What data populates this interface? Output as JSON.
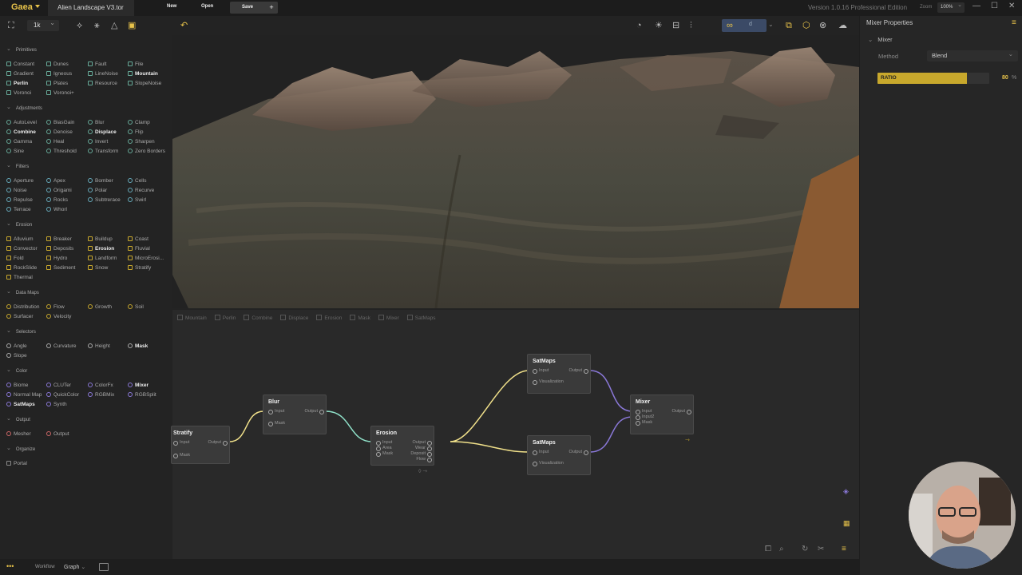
{
  "titlebar": {
    "app_name": "Gaea",
    "document_tab": "Alien Landscape V3.tor",
    "menu_new": "New",
    "menu_open": "Open",
    "menu_save": "Save",
    "menu_plus": "+",
    "version": "Version 1.0.16 Professional Edition",
    "zoom_label": "Zoom",
    "zoom_value": "100%",
    "accent_color": "#e8c34a"
  },
  "toolbar": {
    "resolution": "1k",
    "split_text": "d",
    "icons": [
      "frame-icon",
      "symmetry-icon",
      "wand-icon",
      "terrain-icon",
      "viewport-icon",
      "undo-icon",
      "dial-icon",
      "sun-icon",
      "chart-icon",
      "sliders-icon",
      "glasses-icon",
      "cube-outline-icon",
      "cube-icon",
      "close-circle-icon",
      "cloud-icon"
    ]
  },
  "library": {
    "categories": [
      {
        "label": "Primitives",
        "items": [
          "Constant",
          "Dunes",
          "Fault",
          "File",
          "Gradient",
          "Igneous",
          "LineNoise",
          "Mountain",
          "Perlin",
          "Plates",
          "Resource",
          "SlopeNoise",
          "Voronoi",
          "Voronoi+"
        ]
      },
      {
        "label": "Adjustments",
        "items": [
          "AutoLevel",
          "BiasGain",
          "Blur",
          "Clamp",
          "Combine",
          "Denoise",
          "Displace",
          "Flip",
          "Gamma",
          "Heal",
          "Invert",
          "Sharpen",
          "Sine",
          "Threshold",
          "Transform",
          "Zero Borders"
        ]
      },
      {
        "label": "Filters",
        "items": [
          "Aperture",
          "Apex",
          "Bomber",
          "Cells",
          "Noise",
          "Origami",
          "Polar",
          "Recurve",
          "Repulse",
          "Rocks",
          "Subtrerace",
          "Swirl",
          "Terrace",
          "Whorl"
        ]
      },
      {
        "label": "Erosion",
        "items": [
          "Alluvium",
          "Breaker",
          "Buildup",
          "Coast",
          "Convector",
          "Deposits",
          "Erosion",
          "Fluvial",
          "Fold",
          "Hydro",
          "Landform",
          "MicroErosi...",
          "RockSlide",
          "Sediment",
          "Snow",
          "Stratify",
          "Thermal"
        ]
      },
      {
        "label": "Data Maps",
        "items": [
          "Distribution",
          "Flow",
          "Growth",
          "Soil",
          "Surfacer",
          "Velocity"
        ]
      },
      {
        "label": "Selectors",
        "items": [
          "Angle",
          "Curvature",
          "Height",
          "Mask",
          "Slope"
        ]
      },
      {
        "label": "Color",
        "items": [
          "Biome",
          "CLUTer",
          "ColorFx",
          "Mixer",
          "Normal Map",
          "QuickColor",
          "RGBMix",
          "RGBSplit",
          "SatMaps",
          "Synth"
        ]
      },
      {
        "label": "Output",
        "items": [
          "Mesher",
          "Output"
        ]
      },
      {
        "label": "Organize",
        "items": [
          "Portal"
        ]
      }
    ]
  },
  "graph": {
    "breadcrumb": [
      "Mountain",
      "Perlin",
      "Combine",
      "Displace",
      "Erosion",
      "Mask",
      "Mixer",
      "SatMaps"
    ],
    "nodes": {
      "stratify": {
        "title": "Stratify",
        "inputs": [
          "Input",
          "Mask"
        ],
        "outputs": [
          "Output"
        ]
      },
      "blur": {
        "title": "Blur",
        "inputs": [
          "Input",
          "Mask"
        ],
        "outputs": [
          "Output"
        ]
      },
      "erosion": {
        "title": "Erosion",
        "inputs": [
          "Input",
          "Area",
          "Mask"
        ],
        "outputs": [
          "Output",
          "Wear",
          "Deposit",
          "Flow"
        ]
      },
      "satmaps1": {
        "title": "SatMaps",
        "inputs": [
          "Input",
          "Visualization"
        ],
        "outputs": [
          "Output"
        ]
      },
      "satmaps2": {
        "title": "SatMaps",
        "inputs": [
          "Input",
          "Visualization"
        ],
        "outputs": [
          "Output"
        ]
      },
      "mixer": {
        "title": "Mixer",
        "inputs": [
          "Input",
          "Input2",
          "Mask"
        ],
        "outputs": [
          "Output"
        ]
      }
    }
  },
  "properties": {
    "title": "Mixer Properties",
    "section": "Mixer",
    "method_label": "Method",
    "method_value": "Blend",
    "ratio_label": "RATIO",
    "ratio_value": "80",
    "ratio_unit": "%",
    "ratio_fraction": 0.8
  },
  "statusbar": {
    "menu_dots": "•••",
    "workflow_label": "Workflow",
    "workflow_value": "Graph"
  }
}
